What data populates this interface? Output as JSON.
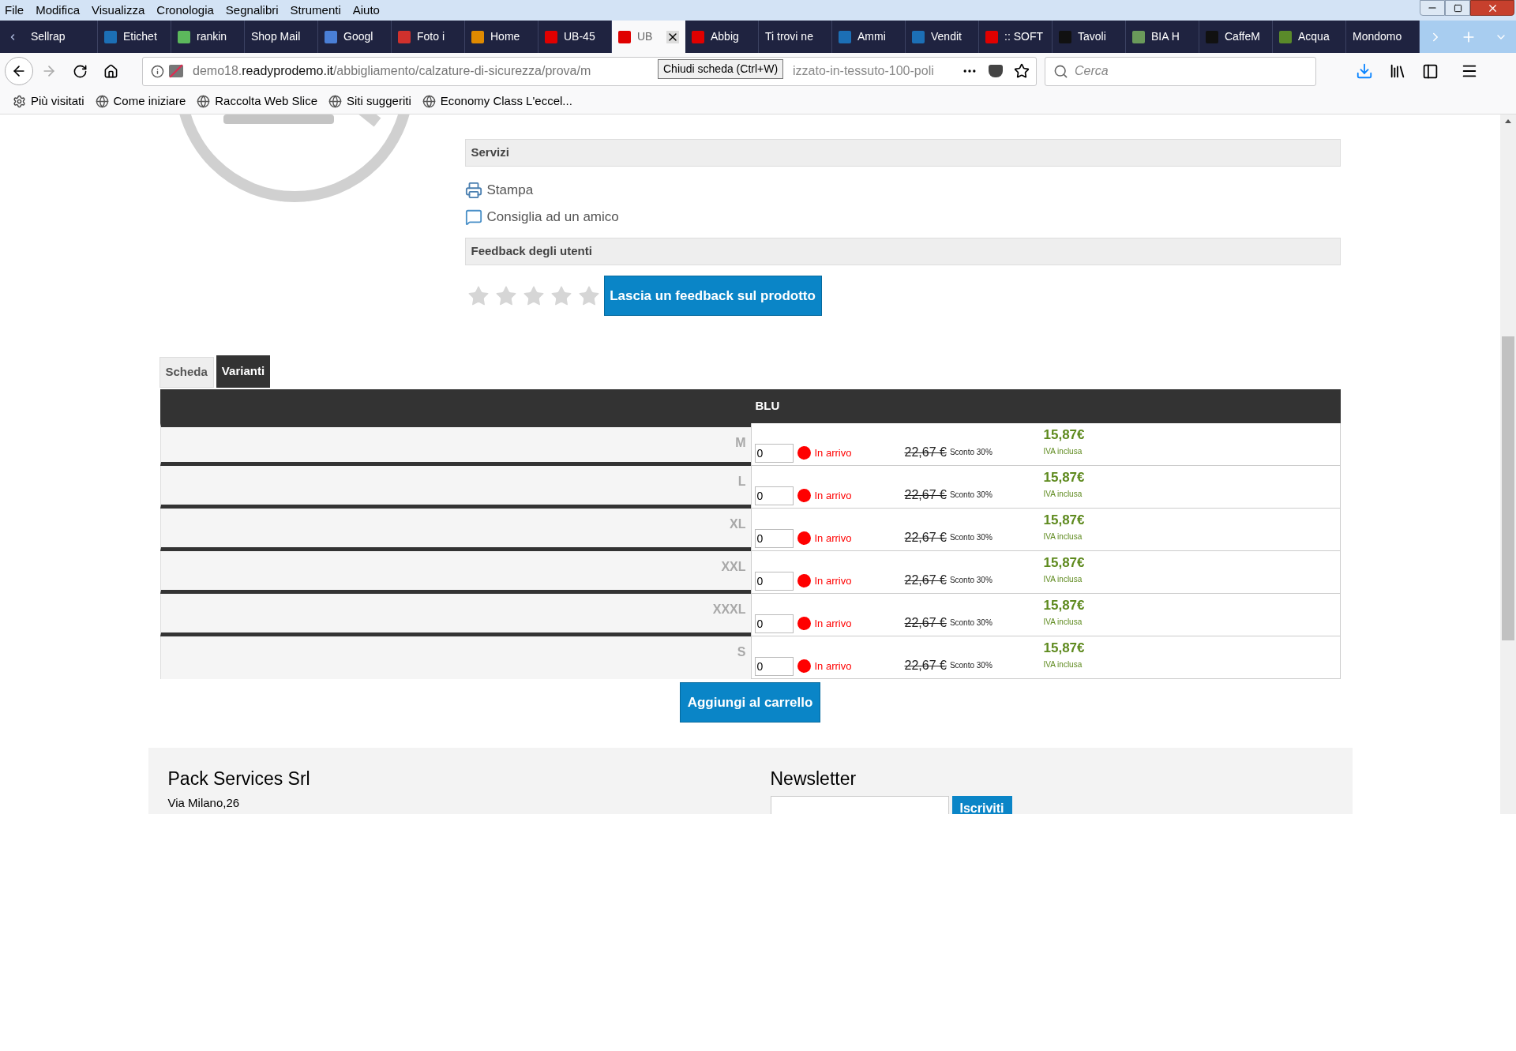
{
  "menu_bar": [
    "File",
    "Modifica",
    "Visualizza",
    "Cronologia",
    "Segnalibri",
    "Strumenti",
    "Aiuto"
  ],
  "tabs": [
    {
      "label": "Sellrap",
      "selected": false
    },
    {
      "label": "Etichet",
      "selected": false
    },
    {
      "label": "rankin",
      "selected": false
    },
    {
      "label": "Shop Mail",
      "selected": false
    },
    {
      "label": "Googl",
      "selected": false
    },
    {
      "label": "Foto i",
      "selected": false
    },
    {
      "label": "Home",
      "selected": false
    },
    {
      "label": "UB-45",
      "selected": false
    },
    {
      "label": "UB",
      "selected": true
    },
    {
      "label": "Abbig",
      "selected": false
    },
    {
      "label": "Ti trovi ne",
      "selected": false
    },
    {
      "label": "Ammi",
      "selected": false
    },
    {
      "label": "Vendit",
      "selected": false
    },
    {
      "label": ":: SOFT",
      "selected": false
    },
    {
      "label": "Tavoli",
      "selected": false
    },
    {
      "label": "BIA H",
      "selected": false
    },
    {
      "label": "CaffeM",
      "selected": false
    },
    {
      "label": "Acqua",
      "selected": false
    },
    {
      "label": "Mondomo",
      "selected": false
    }
  ],
  "address_bar": {
    "prefix": "demo18.",
    "domain": "readyprodemo.it",
    "path": "/abbigliamento/calzature-di-sicurezza/prova/m",
    "tail": "izzato-in-tessuto-100-poli"
  },
  "tooltip": "Chiudi scheda (Ctrl+W)",
  "search": {
    "placeholder": "Cerca"
  },
  "bookmarks": [
    "Più visitati",
    "Come iniziare",
    "Raccolta Web Slice",
    "Siti suggeriti",
    "Economy Class L'eccel..."
  ],
  "product": {
    "services_title": "Servizi",
    "services": [
      "Stampa",
      "Consiglia ad un amico"
    ],
    "feedback_title": "Feedback degli utenti",
    "stars": 0,
    "feedback_button": "Lascia un feedback sul prodotto"
  },
  "detail_tabs": [
    {
      "label": "Scheda",
      "selected": false
    },
    {
      "label": "Varianti",
      "selected": true
    }
  ],
  "variants": {
    "column": "BLU",
    "rows": [
      {
        "size": "M",
        "qty": "0",
        "status": "In arrivo",
        "color": "#ff0000",
        "old_price": "22,67 €",
        "discount": "Sconto 30%",
        "price": "15,87€",
        "vat": "IVA inclusa"
      },
      {
        "size": "L",
        "qty": "0",
        "status": "In arrivo",
        "color": "#ff0000",
        "old_price": "22,67 €",
        "discount": "Sconto 30%",
        "price": "15,87€",
        "vat": "IVA inclusa"
      },
      {
        "size": "XL",
        "qty": "0",
        "status": "In arrivo",
        "color": "#ff0000",
        "old_price": "22,67 €",
        "discount": "Sconto 30%",
        "price": "15,87€",
        "vat": "IVA inclusa"
      },
      {
        "size": "XXL",
        "qty": "0",
        "status": "In arrivo",
        "color": "#ff0000",
        "old_price": "22,67 €",
        "discount": "Sconto 30%",
        "price": "15,87€",
        "vat": "IVA inclusa"
      },
      {
        "size": "XXXL",
        "qty": "0",
        "status": "In arrivo",
        "color": "#ff0000",
        "old_price": "22,67 €",
        "discount": "Sconto 30%",
        "price": "15,87€",
        "vat": "IVA inclusa"
      },
      {
        "size": "S",
        "qty": "0",
        "status": "In arrivo",
        "color": "#ff0000",
        "old_price": "22,67 €",
        "discount": "Sconto 30%",
        "price": "15,87€",
        "vat": "IVA inclusa"
      }
    ],
    "add_button": "Aggiungi al carrello"
  },
  "footer": {
    "company": "Pack Services Srl",
    "address": "Via Milano,26",
    "newsletter_title": "Newsletter",
    "subscribe_button": "Iscriviti"
  }
}
